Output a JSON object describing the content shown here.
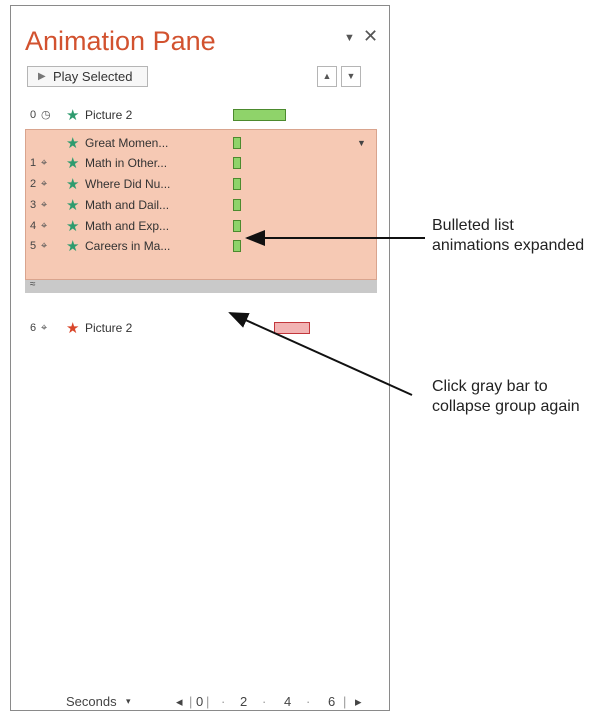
{
  "pane": {
    "title": "Animation Pane",
    "play_label": "Play Selected",
    "move_up_glyph": "▲",
    "move_down_glyph": "▼",
    "header_menu_glyph": "▼",
    "close_glyph": "✕"
  },
  "rows": [
    {
      "num": "0",
      "trigger_icon": "clock-icon",
      "trigger": "◷",
      "star_color": "green",
      "label": "Picture 2",
      "bar": {
        "start_fraction": 0.0,
        "length_fraction": 0.36,
        "color": "#8fd36a"
      }
    },
    {
      "num": "",
      "trigger_icon": "",
      "trigger": "",
      "star_color": "green",
      "label": "Great Momen...",
      "bar": {
        "start_fraction": 0.0,
        "length_fraction": 0.05,
        "color": "#8fd36a"
      }
    },
    {
      "num": "1",
      "trigger_icon": "mouse-click-icon",
      "trigger": "⌖",
      "star_color": "green",
      "label": "Math in Other...",
      "bar": {
        "start_fraction": 0.0,
        "length_fraction": 0.05,
        "color": "#8fd36a"
      }
    },
    {
      "num": "2",
      "trigger_icon": "mouse-click-icon",
      "trigger": "⌖",
      "star_color": "green",
      "label": "Where Did Nu...",
      "bar": {
        "start_fraction": 0.0,
        "length_fraction": 0.05,
        "color": "#8fd36a"
      }
    },
    {
      "num": "3",
      "trigger_icon": "mouse-click-icon",
      "trigger": "⌖",
      "star_color": "green",
      "label": "Math and Dail...",
      "bar": {
        "start_fraction": 0.0,
        "length_fraction": 0.05,
        "color": "#8fd36a"
      }
    },
    {
      "num": "4",
      "trigger_icon": "mouse-click-icon",
      "trigger": "⌖",
      "star_color": "green",
      "label": "Math and Exp...",
      "bar": {
        "start_fraction": 0.0,
        "length_fraction": 0.05,
        "color": "#8fd36a"
      }
    },
    {
      "num": "5",
      "trigger_icon": "mouse-click-icon",
      "trigger": "⌖",
      "star_color": "green",
      "label": "Careers in Ma...",
      "bar": {
        "start_fraction": 0.0,
        "length_fraction": 0.05,
        "color": "#8fd36a"
      }
    },
    {
      "num": "6",
      "trigger_icon": "mouse-click-icon",
      "trigger": "⌖",
      "star_color": "red",
      "label": "Picture 2",
      "bar": {
        "start_fraction": 0.28,
        "length_fraction": 0.24,
        "color": "#f2b3b3"
      }
    }
  ],
  "group": {
    "expanded": true,
    "highlight_color": "#f6c9b4",
    "collapse_glyph": "≈"
  },
  "footer": {
    "seconds_label": "Seconds",
    "seconds_caret": "▾",
    "timeline_left": "◂",
    "timeline_right": "▸",
    "ticks": [
      "0",
      "2",
      "4",
      "6"
    ]
  },
  "annotations": {
    "expanded_line1": "Bulleted list",
    "expanded_line2": "animations expanded",
    "collapse_line1": "Click gray bar to",
    "collapse_line2": "collapse group again"
  },
  "colors": {
    "title": "#d2522f",
    "green_star": "#2e9b6e",
    "red_star": "#d9462a",
    "green_bar": "#8fd36a",
    "red_bar": "#f2b3b3"
  }
}
